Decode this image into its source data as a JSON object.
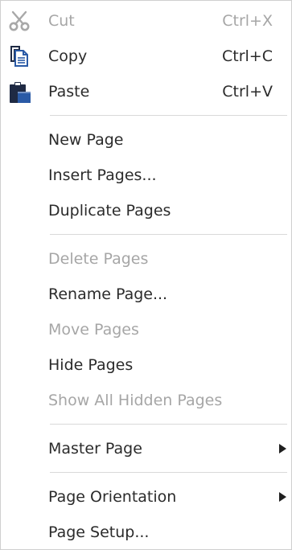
{
  "menu": {
    "items": [
      {
        "label": "Cut",
        "shortcut": "Ctrl+X",
        "icon": "scissors-icon",
        "disabled": true
      },
      {
        "label": "Copy",
        "shortcut": "Ctrl+C",
        "icon": "copy-icon",
        "disabled": false
      },
      {
        "label": "Paste",
        "shortcut": "Ctrl+V",
        "icon": "paste-icon",
        "disabled": false
      },
      {
        "label": "New Page",
        "disabled": false
      },
      {
        "label": "Insert Pages...",
        "disabled": false
      },
      {
        "label": "Duplicate Pages",
        "disabled": false
      },
      {
        "label": "Delete Pages",
        "disabled": true
      },
      {
        "label": "Rename Page...",
        "disabled": false
      },
      {
        "label": "Move Pages",
        "disabled": true
      },
      {
        "label": "Hide Pages",
        "disabled": false
      },
      {
        "label": "Show All Hidden Pages",
        "disabled": true
      },
      {
        "label": "Master Page",
        "submenu": true,
        "disabled": false
      },
      {
        "label": "Page Orientation",
        "submenu": true,
        "disabled": false
      },
      {
        "label": "Page Setup...",
        "disabled": false
      }
    ]
  },
  "colors": {
    "text": "#2b2b2b",
    "disabled_text": "#a6a6a6",
    "separator": "#d9d9d9",
    "icon_dark": "#1f2a44",
    "icon_blue": "#2a5aa6"
  }
}
